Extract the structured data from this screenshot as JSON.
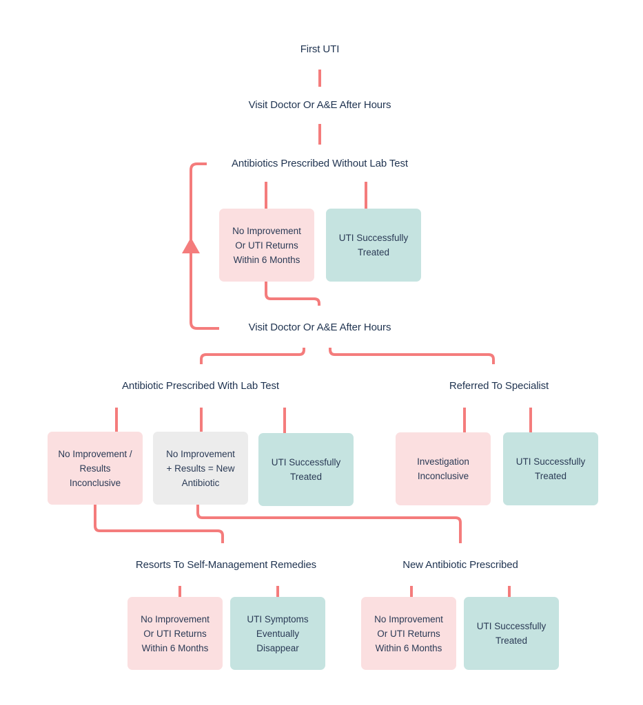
{
  "colors": {
    "connector": "#f47c7c",
    "text": "#1f3350",
    "negative_box": "#fbdfe0",
    "positive_box": "#c5e3e0",
    "neutral_box": "#ececec"
  },
  "steps": {
    "first_uti": "First UTI",
    "visit_doctor_1": "Visit Doctor Or A&E After Hours",
    "antibiotics_without_lab": "Antibiotics Prescribed Without Lab Test",
    "visit_doctor_2": "Visit Doctor Or A&E After Hours",
    "antibiotic_with_lab": "Antibiotic Prescribed With Lab Test",
    "referred_specialist": "Referred To Specialist",
    "self_management": "Resorts To Self-Management Remedies",
    "new_antibiotic": "New Antibiotic Prescribed"
  },
  "outcomes": {
    "without_lab_fail": "No Improvement\nOr UTI Returns\nWithin 6 Months",
    "without_lab_success": "UTI Successfully\nTreated",
    "with_lab_inconclusive": "No Improvement /\nResults Inconclusive",
    "with_lab_new_antibiotic": "No Improvement\n+ Results = New\nAntibiotic",
    "with_lab_success": "UTI Successfully\nTreated",
    "specialist_inconclusive": "Investigation\nInconclusive",
    "specialist_success": "UTI Successfully\nTreated",
    "self_management_fail": "No Improvement\nOr UTI Returns\nWithin 6 Months",
    "self_management_success": "UTI Symptoms\nEventually\nDisappear",
    "new_antibiotic_fail": "No Improvement\nOr UTI Returns\nWithin 6 Months",
    "new_antibiotic_success": "UTI Successfully\nTreated"
  },
  "icons": {
    "loop_arrow": "arrow-up-icon"
  }
}
